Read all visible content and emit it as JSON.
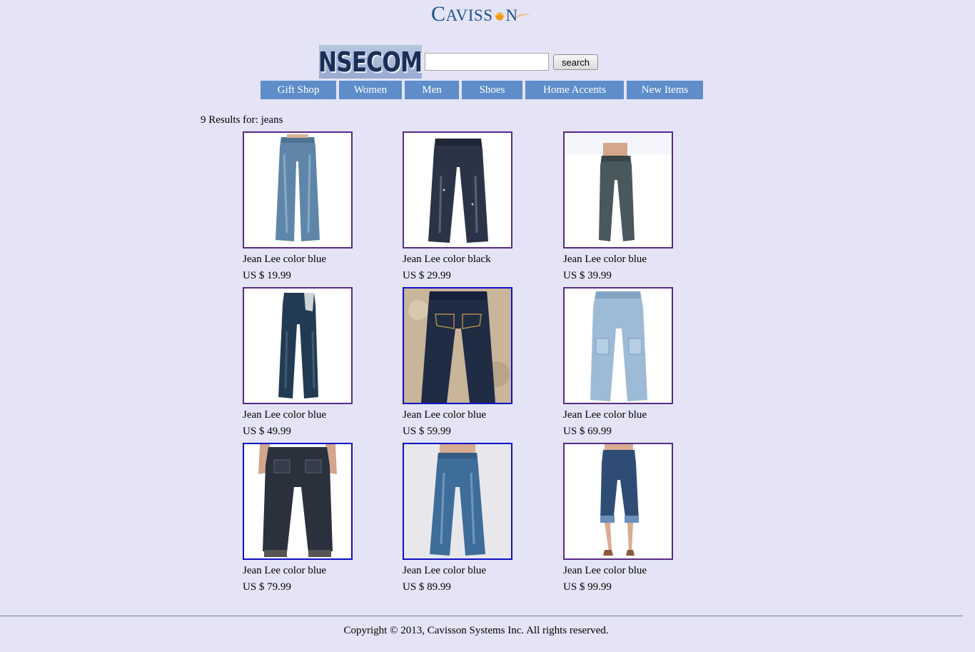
{
  "brand": {
    "logo_text_first": "C",
    "logo_text_rest": "AVISS",
    "logo_text_end": "N",
    "logo_colors": {
      "text": "#1d5290",
      "sun": "#f29a1b"
    },
    "banner_text": "NSECOM"
  },
  "search": {
    "value": "",
    "placeholder": "",
    "button_label": "search"
  },
  "nav": {
    "items": [
      {
        "label": "Gift Shop"
      },
      {
        "label": "Women"
      },
      {
        "label": "Men"
      },
      {
        "label": "Shoes"
      },
      {
        "label": "Home Accents"
      },
      {
        "label": "New Items"
      }
    ]
  },
  "results": {
    "label": "9 Results for: jeans"
  },
  "products": [
    {
      "name": "Jean Lee color blue",
      "price": "US $ 19.99",
      "image": "wide-leg-jeans-photo"
    },
    {
      "name": "Jean Lee color black",
      "price": "US $ 29.99",
      "image": "dark-wash-jeans-photo"
    },
    {
      "name": "Jean Lee color blue",
      "price": "US $ 39.99",
      "image": "grey-jeans-photo"
    },
    {
      "name": "Jean Lee color blue",
      "price": "US $ 49.99",
      "image": "straight-leg-jeans-photo"
    },
    {
      "name": "Jean Lee color blue",
      "price": "US $ 59.99",
      "image": "jeans-on-stone-photo"
    },
    {
      "name": "Jean Lee color blue",
      "price": "US $ 69.99",
      "image": "light-wash-cargo-jeans-photo"
    },
    {
      "name": "Jean Lee color blue",
      "price": "US $ 79.99",
      "image": "back-view-jeans-photo"
    },
    {
      "name": "Jean Lee color blue",
      "price": "US $ 89.99",
      "image": "flare-jeans-photo"
    },
    {
      "name": "Jean Lee color blue",
      "price": "US $ 99.99",
      "image": "cropped-jeans-photo"
    }
  ],
  "footer": {
    "copyright": "Copyright © 2013, Cavisson Systems Inc. All rights reserved."
  }
}
